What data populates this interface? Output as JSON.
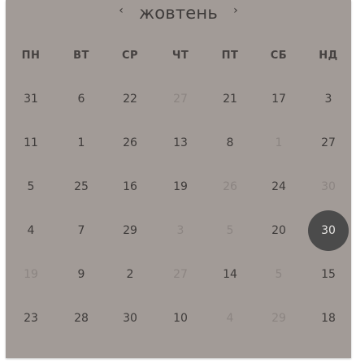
{
  "header": {
    "title": "жовтень",
    "prev_label": "‹",
    "next_label": "›"
  },
  "weekdays": [
    "ПН",
    "ВТ",
    "СР",
    "ЧТ",
    "ПТ",
    "СБ",
    "НД"
  ],
  "weeks": [
    [
      {
        "label": "31",
        "muted": false
      },
      {
        "label": "6",
        "muted": false
      },
      {
        "label": "22",
        "muted": false
      },
      {
        "label": "27",
        "muted": true
      },
      {
        "label": "21",
        "muted": false
      },
      {
        "label": "17",
        "muted": false
      },
      {
        "label": "3",
        "muted": false
      }
    ],
    [
      {
        "label": "11",
        "muted": false
      },
      {
        "label": "1",
        "muted": false
      },
      {
        "label": "26",
        "muted": false
      },
      {
        "label": "13",
        "muted": false
      },
      {
        "label": "8",
        "muted": false
      },
      {
        "label": "1",
        "muted": true
      },
      {
        "label": "27",
        "muted": false
      }
    ],
    [
      {
        "label": "5",
        "muted": false
      },
      {
        "label": "25",
        "muted": false
      },
      {
        "label": "16",
        "muted": false
      },
      {
        "label": "19",
        "muted": false
      },
      {
        "label": "26",
        "muted": true
      },
      {
        "label": "24",
        "muted": false
      },
      {
        "label": "30",
        "muted": true
      }
    ],
    [
      {
        "label": "4",
        "muted": false
      },
      {
        "label": "7",
        "muted": false
      },
      {
        "label": "29",
        "muted": false
      },
      {
        "label": "3",
        "muted": true
      },
      {
        "label": "5",
        "muted": true
      },
      {
        "label": "20",
        "muted": false
      },
      {
        "label": "30",
        "muted": false,
        "selected": true
      }
    ],
    [
      {
        "label": "19",
        "muted": true
      },
      {
        "label": "9",
        "muted": false
      },
      {
        "label": "2",
        "muted": false
      },
      {
        "label": "27",
        "muted": true
      },
      {
        "label": "14",
        "muted": false
      },
      {
        "label": "5",
        "muted": true
      },
      {
        "label": "15",
        "muted": false
      }
    ],
    [
      {
        "label": "23",
        "muted": false
      },
      {
        "label": "28",
        "muted": false
      },
      {
        "label": "30",
        "muted": false
      },
      {
        "label": "10",
        "muted": false
      },
      {
        "label": "4",
        "muted": true
      },
      {
        "label": "29",
        "muted": true
      },
      {
        "label": "18",
        "muted": false
      }
    ]
  ],
  "colors": {
    "background": "#a29b97",
    "text": "#3e3b3a",
    "muted_text": "#8c8582",
    "selected_bg": "#4b4b4b",
    "selected_text": "#e6e4e2"
  }
}
